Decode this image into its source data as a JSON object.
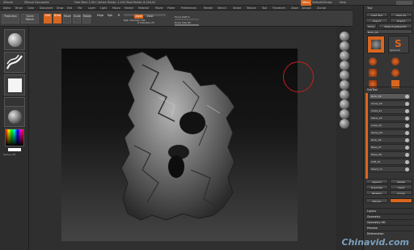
{
  "titlebar": {
    "app": "ZBrush",
    "doc": "ZBrush Document",
    "stats": "Free Mem 2.50+ Active Points: 1,100 Total Points: 8,204,000",
    "menu": "Menu",
    "default_script": "DefaultZScript",
    "help": "Help"
  },
  "menubar": [
    "Alpha",
    "Brush",
    "Color",
    "Document",
    "Draw",
    "Edit",
    "File",
    "Layer",
    "Light",
    "Macro",
    "Marker",
    "Material",
    "Movie",
    "Picker",
    "Preferences",
    "Render",
    "Stencil",
    "Stroke",
    "Texture",
    "Tool",
    "Transform",
    "Zoom",
    "Zplugin",
    "Zscript"
  ],
  "toolbar": {
    "projection": "Projection",
    "master": "Master",
    "lightbox": "LightBox",
    "quick": "Quick Sketch",
    "edit": "Edit",
    "draw": "Draw",
    "move": "Move",
    "scale": "Scale",
    "rotate": "Rotate",
    "mrgb": "Mrgb",
    "rgb": "Rgb",
    "m": "M",
    "zadd": "Zadd",
    "zsub": "Zsub",
    "rgb_intensity": "Rgb Intensity 100",
    "z_intensity": "Z Intensity 25",
    "focal_shift": "Focal Shift 0",
    "draw_size": "Draw Size 64",
    "zcut": "Zcut"
  },
  "leftshelf": {
    "texture_off": "Texture Off"
  },
  "rightshelf": [
    "Bpr",
    "Scroll",
    "Zoom",
    "Actual",
    "AAHalf",
    "Frame",
    "Move",
    "Scale",
    "Rotate",
    "Transp"
  ],
  "panel": {
    "title": "Tool",
    "load_tool": "Load Tool",
    "save_as": "Save As",
    "import": "Import",
    "export": "Export",
    "clone": "Clone",
    "make_polymesh": "Make PolyMesh3D",
    "rock": "Rock_09",
    "sphere": "Sphere3D",
    "sub_tool": "SubTool",
    "list_all": "List All",
    "append": "Append",
    "delete": "Delete",
    "duplicate": "Duplicate",
    "insert": "Insert",
    "rename": "Rename",
    "group": "Group",
    "extract": "Extract",
    "layers": "Layers",
    "geometry": "Geometry",
    "geometry_hd": "Geometry HD",
    "preview": "Preview",
    "deformation": "Deformation"
  },
  "subtools": [
    "Rock_09",
    "Clone_02",
    "Cloth_01",
    "Plane_03",
    "Cube_04",
    "Stone_05",
    "Rock_06",
    "Base_07",
    "Moss_08",
    "Cliff_10",
    "Shard_11"
  ],
  "watermark": "Chinavid.com"
}
